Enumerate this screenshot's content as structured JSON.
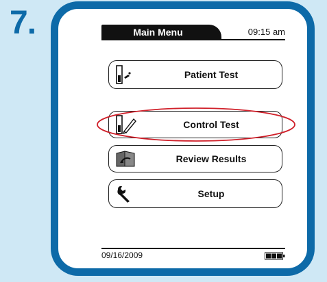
{
  "step": {
    "number": "7."
  },
  "header": {
    "title": "Main Menu",
    "time": "09:15 am"
  },
  "menu": {
    "items": [
      {
        "label": "Patient Test",
        "icon": "patient-test-icon"
      },
      {
        "label": "Control Test",
        "icon": "control-test-icon",
        "highlighted": true
      },
      {
        "label": "Review Results",
        "icon": "review-results-icon"
      },
      {
        "label": "Setup",
        "icon": "wrench-icon"
      }
    ]
  },
  "footer": {
    "date": "09/16/2009",
    "battery_icon": "battery-icon"
  },
  "colors": {
    "frame": "#0d6aa8",
    "background": "#cfe8f5",
    "highlight": "#d0202a"
  }
}
